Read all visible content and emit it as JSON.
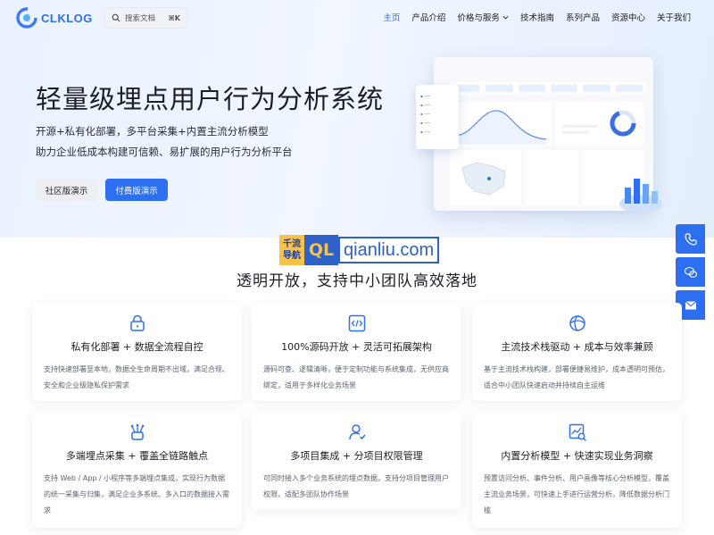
{
  "header": {
    "logo_text": "CLKLOG",
    "search": {
      "placeholder": "搜索文档",
      "shortcut": "⌘K"
    },
    "nav": [
      {
        "label": "主页",
        "active": true
      },
      {
        "label": "产品介绍"
      },
      {
        "label": "价格与服务",
        "has_dropdown": true
      },
      {
        "label": "技术指南"
      },
      {
        "label": "系列产品"
      },
      {
        "label": "资源中心"
      },
      {
        "label": "关于我们"
      }
    ]
  },
  "hero": {
    "title": "轻量级埋点用户行为分析系统",
    "subtitle_1": "开源+私有化部署，多平台采集+内置主流分析模型",
    "subtitle_2": "助力企业低成本构建可信赖、易扩展的用户行为分析平台",
    "buttons": {
      "community": "社区版演示",
      "paid": "付费版演示"
    }
  },
  "watermark": {
    "left_line1": "千流",
    "left_line2": "导航",
    "mid": "QL",
    "right": "qianliu.com"
  },
  "floating": [
    {
      "icon": "phone-icon"
    },
    {
      "icon": "wechat-icon"
    },
    {
      "icon": "mail-icon"
    }
  ],
  "section": {
    "title": "透明开放，支持中小团队高效落地"
  },
  "features": [
    {
      "icon": "lock-icon",
      "title": "私有化部署 + 数据全流程自控",
      "desc": "支持快速部署至本地，数据全生命周期不出域，满足合规、安全和企业级隐私保护需求"
    },
    {
      "icon": "code-icon",
      "title": "100%源码开放 + 灵活可拓展架构",
      "desc": "源码可查、逻辑清晰，便于定制功能与系统集成，无供应商绑定，适用于多样化业务场景"
    },
    {
      "icon": "tech-stack-icon",
      "title": "主流技术栈驱动 + 成本与效率兼顾",
      "desc": "基于主流技术栈构建，部署便捷易维护，成本透明可预估，适合中小团队快速启动并持续自主运维"
    },
    {
      "icon": "multi-collect-icon",
      "title": "多端埋点采集 + 覆盖全链路触点",
      "desc": "支持 Web / App / 小程序等多端埋点集成，实现行为数据的统一采集与归集，满足企业多系统、多入口的数据接入需求"
    },
    {
      "icon": "user-permission-icon",
      "title": "多项目集成 + 分项目权限管理",
      "desc": "可同时接入多个业务系统的埋点数据，支持分项目管理用户权限，适配多团队协作场景"
    },
    {
      "icon": "analysis-model-icon",
      "title": "内置分析模型 + 快速实现业务洞察",
      "desc": "预置访问分析、事件分析、用户画像等核心分析模型，覆盖主流业务场景，可快速上手进行运营分析，降低数据分析门槛"
    }
  ]
}
